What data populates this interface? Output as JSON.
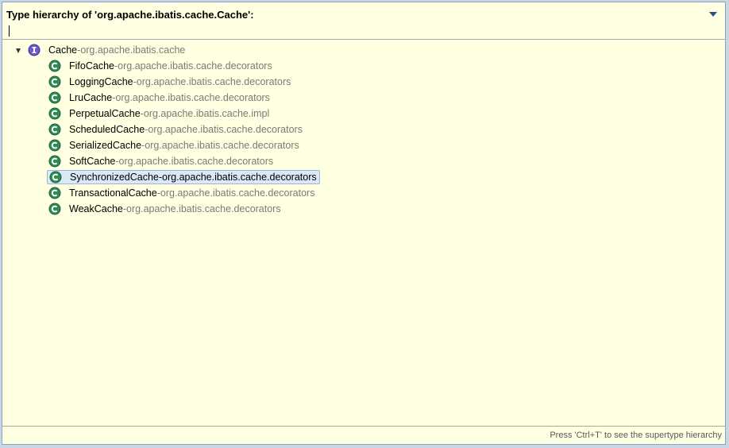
{
  "header": {
    "title": "Type hierarchy of 'org.apache.ibatis.cache.Cache':",
    "filter_value": ""
  },
  "tree": {
    "separator": " - ",
    "root": {
      "name": "Cache",
      "package": "org.apache.ibatis.cache",
      "icon": "interface-icon"
    },
    "children": [
      {
        "name": "FifoCache",
        "package": "org.apache.ibatis.cache.decorators",
        "icon": "class-icon"
      },
      {
        "name": "LoggingCache",
        "package": "org.apache.ibatis.cache.decorators",
        "icon": "class-icon"
      },
      {
        "name": "LruCache",
        "package": "org.apache.ibatis.cache.decorators",
        "icon": "class-icon"
      },
      {
        "name": "PerpetualCache",
        "package": "org.apache.ibatis.cache.impl",
        "icon": "class-icon"
      },
      {
        "name": "ScheduledCache",
        "package": "org.apache.ibatis.cache.decorators",
        "icon": "class-icon"
      },
      {
        "name": "SerializedCache",
        "package": "org.apache.ibatis.cache.decorators",
        "icon": "class-icon"
      },
      {
        "name": "SoftCache",
        "package": "org.apache.ibatis.cache.decorators",
        "icon": "class-icon"
      },
      {
        "name": "SynchronizedCache",
        "package": "org.apache.ibatis.cache.decorators",
        "icon": "class-icon",
        "selected": true
      },
      {
        "name": "TransactionalCache",
        "package": "org.apache.ibatis.cache.decorators",
        "icon": "class-icon"
      },
      {
        "name": "WeakCache",
        "package": "org.apache.ibatis.cache.decorators",
        "icon": "class-icon"
      }
    ]
  },
  "footer": {
    "hint": "Press 'Ctrl+T' to see the supertype hierarchy"
  },
  "colors": {
    "background": "#ffffe1",
    "class_icon": "#2e8b57",
    "interface_icon": "#6a5acd",
    "selection": "#dbe8f6"
  }
}
